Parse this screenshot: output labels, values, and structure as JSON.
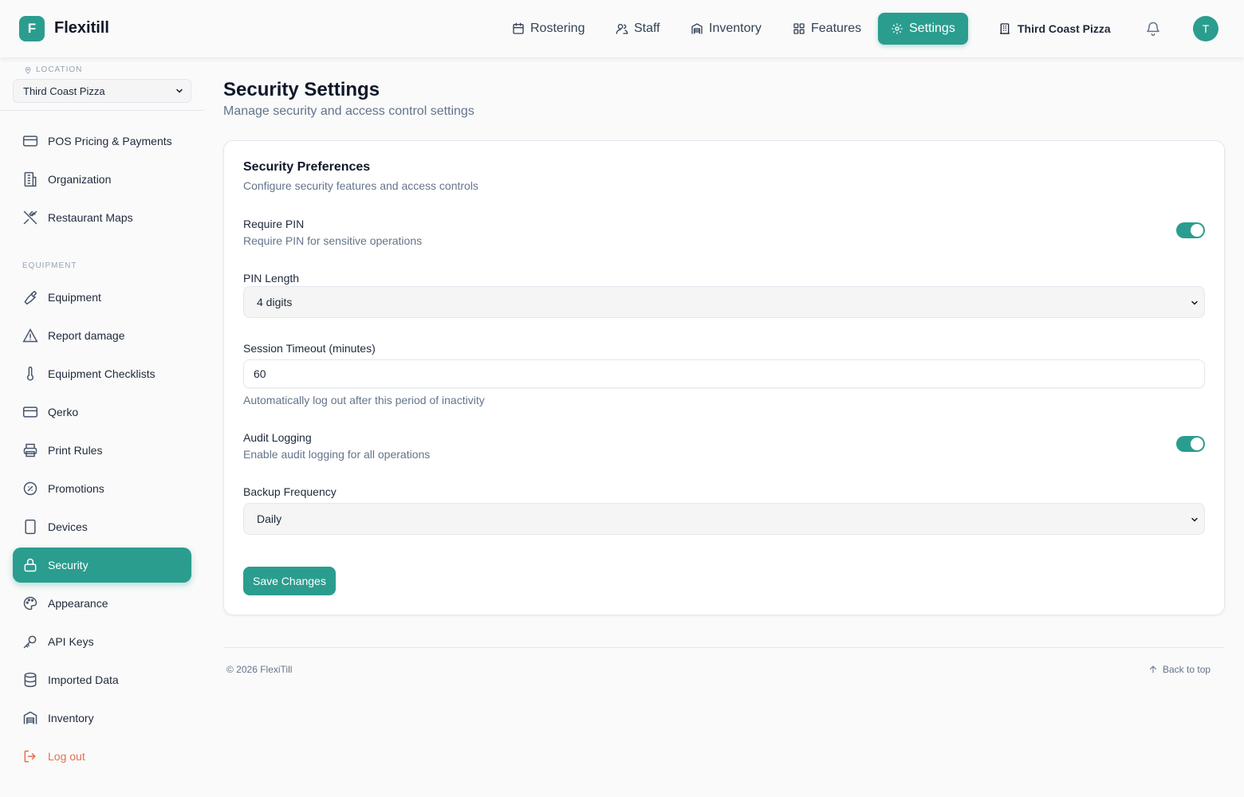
{
  "app": {
    "logo_letter": "F",
    "name": "Flexitill"
  },
  "topnav": {
    "items": [
      {
        "label": "Rostering",
        "icon": "calendar-icon"
      },
      {
        "label": "Staff",
        "icon": "users-icon"
      },
      {
        "label": "Inventory",
        "icon": "warehouse-icon"
      },
      {
        "label": "Features",
        "icon": "grid-icon"
      },
      {
        "label": "Settings",
        "icon": "gear-icon",
        "active": true
      }
    ],
    "location": "Third Coast Pizza",
    "avatar_initial": "T"
  },
  "sidebar": {
    "location_label": "LOCATION",
    "location_value": "Third Coast Pizza",
    "section_equipment": "EQUIPMENT",
    "items": [
      {
        "label": "POS Pricing & Payments",
        "icon": "credit-card-icon"
      },
      {
        "label": "Organization",
        "icon": "building-icon"
      },
      {
        "label": "Restaurant Maps",
        "icon": "utensils-crossed-icon"
      },
      {
        "label": "Equipment",
        "icon": "wrench-icon"
      },
      {
        "label": "Report damage",
        "icon": "alert-triangle-icon"
      },
      {
        "label": "Equipment Checklists",
        "icon": "thermometer-icon"
      },
      {
        "label": "Qerko",
        "icon": "credit-card-icon"
      },
      {
        "label": "Print Rules",
        "icon": "printer-icon"
      },
      {
        "label": "Promotions",
        "icon": "badge-percent-icon"
      },
      {
        "label": "Devices",
        "icon": "tablet-icon"
      },
      {
        "label": "Security",
        "icon": "lock-icon",
        "active": true
      },
      {
        "label": "Appearance",
        "icon": "palette-icon"
      },
      {
        "label": "API Keys",
        "icon": "key-icon"
      },
      {
        "label": "Imported Data",
        "icon": "database-icon"
      },
      {
        "label": "Inventory",
        "icon": "warehouse-icon"
      },
      {
        "label": "Log out",
        "icon": "logout-icon"
      }
    ]
  },
  "page": {
    "title": "Security Settings",
    "subtitle": "Manage security and access control settings"
  },
  "card": {
    "title": "Security Preferences",
    "description": "Configure security features and access controls",
    "require_pin": {
      "label": "Require PIN",
      "help": "Require PIN for sensitive operations",
      "enabled": true
    },
    "pin_length": {
      "label": "PIN Length",
      "value": "4 digits"
    },
    "session_timeout": {
      "label": "Session Timeout (minutes)",
      "value": "60",
      "help": "Automatically log out after this period of inactivity"
    },
    "audit_logging": {
      "label": "Audit Logging",
      "help": "Enable audit logging for all operations",
      "enabled": true
    },
    "backup_frequency": {
      "label": "Backup Frequency",
      "value": "Daily"
    },
    "save_label": "Save Changes"
  },
  "footer": {
    "copyright": "© 2026 FlexiTill",
    "back_to_top": "Back to top"
  },
  "colors": {
    "accent": "#2a9d8f",
    "danger": "#e76f51"
  }
}
